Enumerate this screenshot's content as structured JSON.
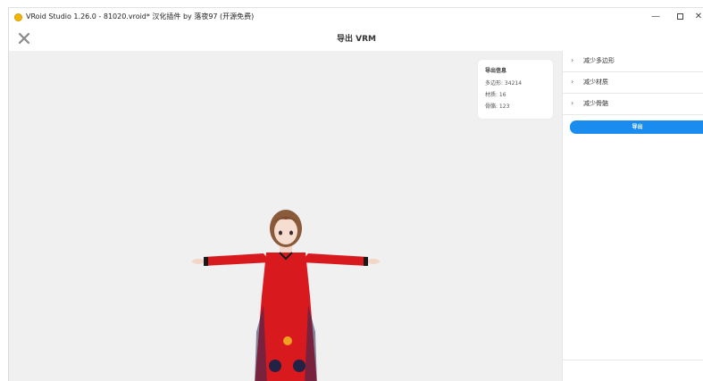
{
  "window": {
    "title": "VRoid Studio 1.26.0 - 81020.vroid* 汉化插件 by 落夜97 (开源免费)",
    "min_label": "—",
    "close_label": "✕"
  },
  "header": {
    "title": "导出 VRM"
  },
  "info_card": {
    "title": "导出信息",
    "polygons": "多边形: 34214",
    "materials": "材质: 16",
    "bones": "骨骼: 123"
  },
  "panel": {
    "items": [
      {
        "label": "减少多边形"
      },
      {
        "label": "减少材质"
      },
      {
        "label": "减少骨骼"
      }
    ],
    "export_label": "导出"
  },
  "colors": {
    "accent": "#1a8cf0",
    "viewport_bg": "#f0f0f0",
    "dress_red": "#d8191e"
  }
}
